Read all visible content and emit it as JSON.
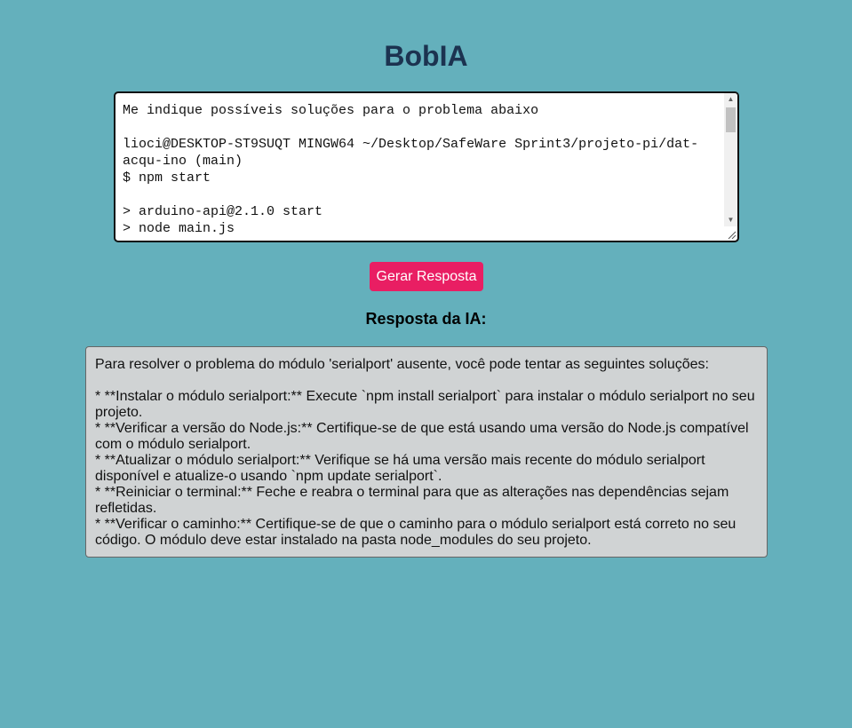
{
  "app": {
    "title": "BobIA"
  },
  "prompt": {
    "value": "Me indique possíveis soluções para o problema abaixo\n\nlioci@DESKTOP-ST9SUQT MINGW64 ~/Desktop/SafeWare Sprint3/projeto-pi/dat-acqu-ino (main)\n$ npm start\n\n> arduino-api@2.1.0 start\n> node main.js"
  },
  "actions": {
    "generate_label": "Gerar Resposta"
  },
  "response": {
    "heading": "Resposta da IA:",
    "text": "Para resolver o problema do módulo 'serialport' ausente, você pode tentar as seguintes soluções:\n\n* **Instalar o módulo serialport:** Execute `npm install serialport` para instalar o módulo serialport no seu projeto.\n* **Verificar a versão do Node.js:** Certifique-se de que está usando uma versão do Node.js compatível com o módulo serialport.\n* **Atualizar o módulo serialport:** Verifique se há uma versão mais recente do módulo serialport disponível e atualize-o usando `npm update serialport`.\n* **Reiniciar o terminal:** Feche e reabra o terminal para que as alterações nas dependências sejam refletidas.\n* **Verificar o caminho:** Certifique-se de que o caminho para o módulo serialport está correto no seu código. O módulo deve estar instalado na pasta node_modules do seu projeto."
  },
  "icons": {
    "scroll_up": "scroll-up-arrow-icon",
    "scroll_down": "scroll-down-arrow-icon",
    "resize": "resize-grip-icon"
  },
  "colors": {
    "background": "#64b0bc",
    "title": "#1c3350",
    "button": "#e91e63",
    "response_box": "#d0d3d4"
  }
}
